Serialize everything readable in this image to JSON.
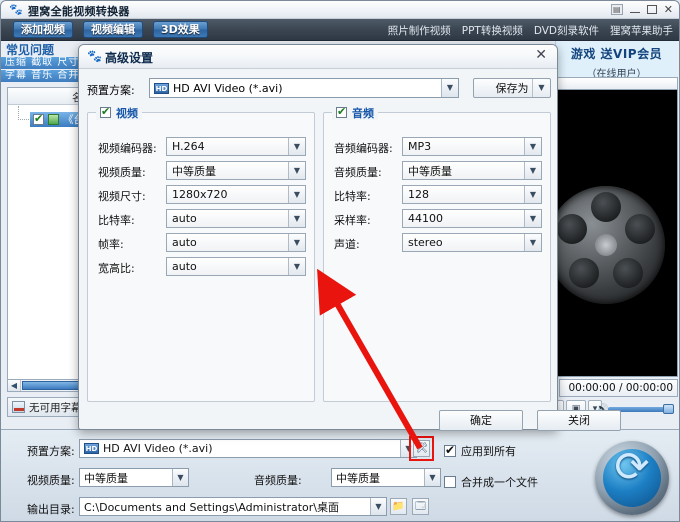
{
  "window": {
    "title": "狸窝全能视频转换器",
    "icon": "app-icon",
    "controls": {
      "restore": "▤",
      "minimize": "—",
      "maximize": "□",
      "close": "✕"
    }
  },
  "toolbar": {
    "buttons": [
      {
        "label": "添加视频"
      },
      {
        "label": "视频编辑"
      },
      {
        "label": "3D效果"
      }
    ],
    "menu_links": [
      {
        "label": "照片制作视频"
      },
      {
        "label": "PPT转换视频"
      },
      {
        "label": "DVD刻录软件"
      },
      {
        "label": "狸窝苹果助手"
      }
    ]
  },
  "sidebar": {
    "faq_title": "常见问题",
    "row1": "压缩 截取 尺寸",
    "row2": "字幕 音乐 合并"
  },
  "filelist": {
    "column_header": "名",
    "row_label": "《台",
    "checked": true,
    "subtitle_status": "无可用字幕"
  },
  "promo": {
    "line1": "游戏 送VIP会员",
    "line2": "（在线用户）"
  },
  "player": {
    "time": "00:00:00 / 00:00:00",
    "volume_level": 95
  },
  "bottom": {
    "preset_label": "预置方案:",
    "preset_value": "HD AVI Video (*.avi)",
    "preset_badge": "HD",
    "video_quality_label": "视频质量:",
    "video_quality_value": "中等质量",
    "audio_quality_label": "音频质量:",
    "audio_quality_value": "中等质量",
    "output_dir_label": "输出目录:",
    "output_dir_value": "C:\\Documents and Settings\\Administrator\\桌面",
    "apply_all_label": "应用到所有",
    "apply_all_checked": true,
    "merge_label": "合并成一个文件",
    "merge_checked": false,
    "settings_icon": "wrench-screwdriver-icon",
    "browse_icon": "folder-icon",
    "open_icon": "open-folder-icon",
    "convert_glyph": "⟳",
    "highlight_color": "#e8140d"
  },
  "dialog": {
    "title": "高级设置",
    "close_label": "✕",
    "preset_label": "预置方案:",
    "preset_value": "HD AVI Video (*.avi)",
    "preset_badge": "HD",
    "save_as_label": "保存为",
    "video": {
      "group_label": "视频",
      "enabled": true,
      "fields": [
        {
          "label": "视频编码器:",
          "value": "H.264"
        },
        {
          "label": "视频质量:",
          "value": "中等质量"
        },
        {
          "label": "视频尺寸:",
          "value": "1280x720"
        },
        {
          "label": "比特率:",
          "value": "auto"
        },
        {
          "label": "帧率:",
          "value": "auto"
        },
        {
          "label": "宽高比:",
          "value": "auto"
        }
      ]
    },
    "audio": {
      "group_label": "音频",
      "enabled": true,
      "fields": [
        {
          "label": "音频编码器:",
          "value": "MP3"
        },
        {
          "label": "音频质量:",
          "value": "中等质量"
        },
        {
          "label": "比特率:",
          "value": "128"
        },
        {
          "label": "采样率:",
          "value": "44100"
        },
        {
          "label": "声道:",
          "value": "stereo"
        }
      ]
    },
    "ok_label": "确定",
    "close_button_label": "关闭"
  }
}
